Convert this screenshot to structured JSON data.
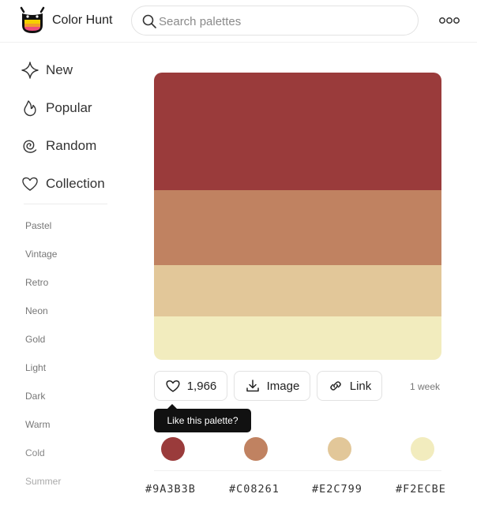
{
  "header": {
    "brand": "Color Hunt",
    "search_placeholder": "Search palettes"
  },
  "sidebar": {
    "nav": [
      {
        "label": "New",
        "icon": "sparkle-icon"
      },
      {
        "label": "Popular",
        "icon": "flame-icon"
      },
      {
        "label": "Random",
        "icon": "swirl-icon"
      },
      {
        "label": "Collection",
        "icon": "heart-icon"
      }
    ],
    "tags": [
      "Pastel",
      "Vintage",
      "Retro",
      "Neon",
      "Gold",
      "Light",
      "Dark",
      "Warm",
      "Cold",
      "Summer"
    ]
  },
  "palette": {
    "colors": [
      "#9A3B3B",
      "#C08261",
      "#E2C799",
      "#F2ECBE"
    ],
    "hex_labels": [
      "#9A3B3B",
      "#C08261",
      "#E2C799",
      "#F2ECBE"
    ],
    "likes": "1,966",
    "image_label": "Image",
    "link_label": "Link",
    "age": "1 week",
    "tooltip": "Like this palette?"
  },
  "colors": {
    "tooltip_bg": "#111111",
    "border": "#e2e2e2"
  }
}
